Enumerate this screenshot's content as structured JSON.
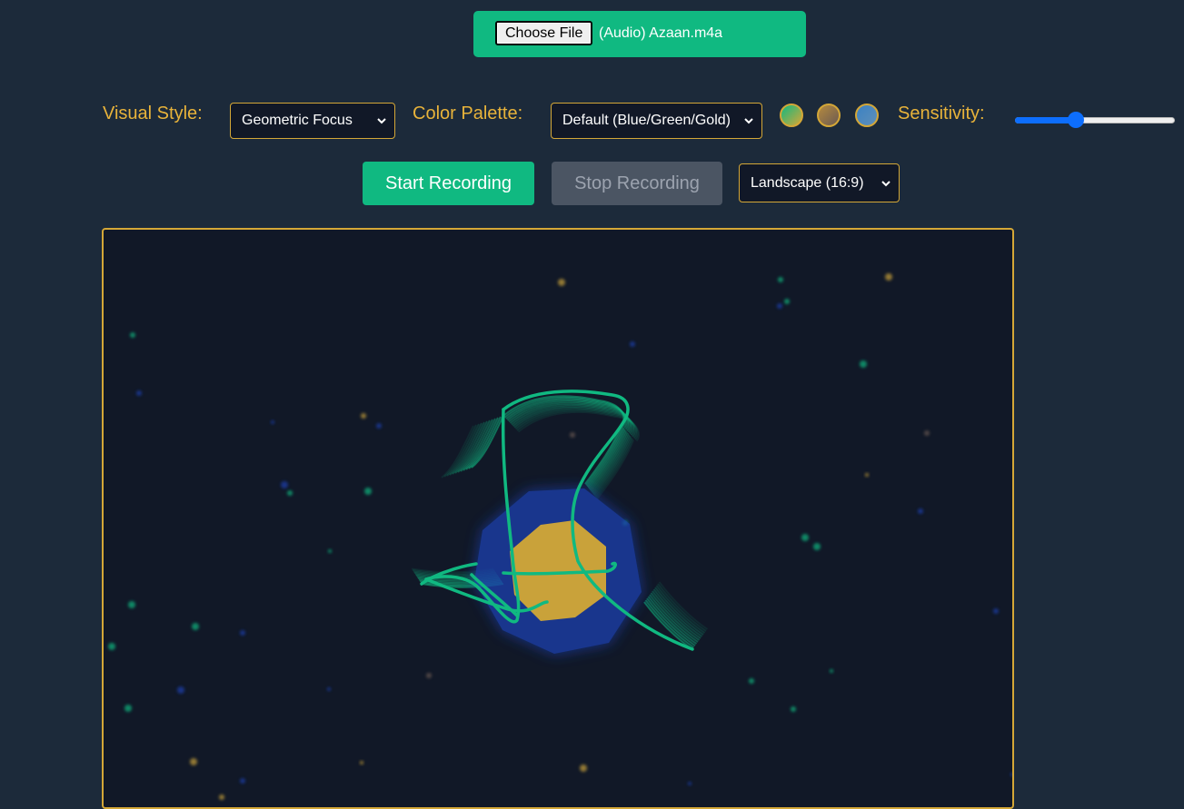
{
  "file_input": {
    "button_label": "Choose File",
    "file_name": "(Audio) Azaan.m4a"
  },
  "controls": {
    "visual_style_label": "Visual Style:",
    "visual_style_value": "Geometric Focus",
    "color_palette_label": "Color Palette:",
    "color_palette_value": "Default (Blue/Green/Gold)",
    "sensitivity_label": "Sensitivity:",
    "sensitivity_value": 0.37,
    "swatches": [
      {
        "name": "green-swatch",
        "from": "#10b981",
        "to": "#d4a737"
      },
      {
        "name": "brown-swatch",
        "from": "#b58a3e",
        "to": "#6b5a52"
      },
      {
        "name": "blue-swatch",
        "from": "#3b82c4",
        "to": "#c9a24a"
      }
    ]
  },
  "recording": {
    "start_label": "Start Recording",
    "stop_label": "Stop Recording",
    "aspect_value": "Landscape (16:9)"
  },
  "colors": {
    "background": "#1c2a3a",
    "accent_green": "#10b981",
    "accent_gold": "#d4a737",
    "canvas_bg": "#111827",
    "shape_blue": "#1e40af",
    "shape_gold": "#c9a23a"
  }
}
